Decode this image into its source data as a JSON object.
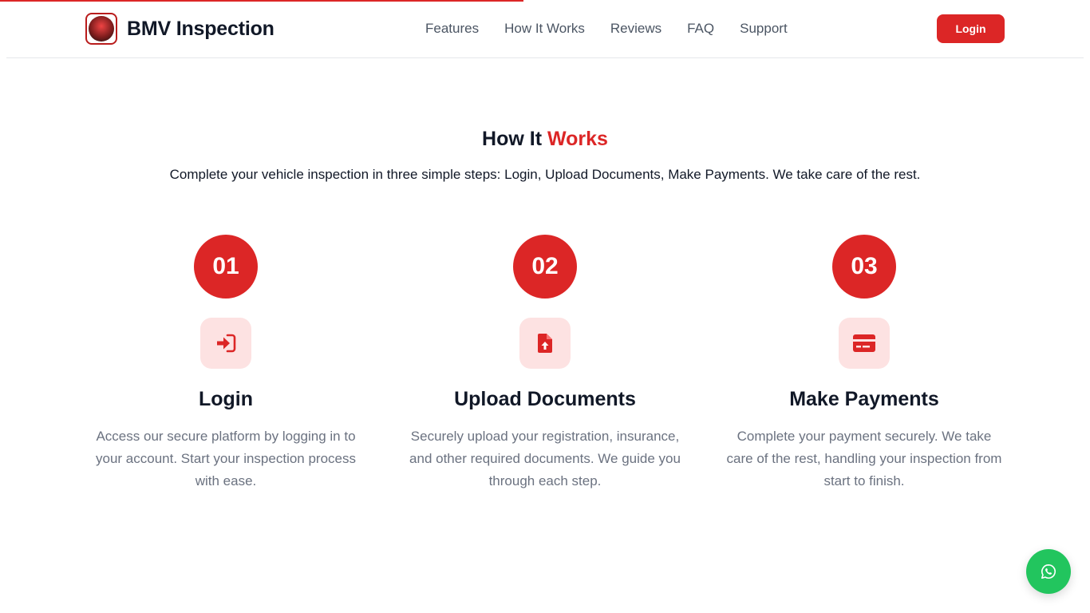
{
  "progress": {
    "percent": 48
  },
  "header": {
    "brand": "BMV Inspection",
    "nav": [
      "Features",
      "How It Works",
      "Reviews",
      "FAQ",
      "Support"
    ],
    "login_label": "Login"
  },
  "section": {
    "title_main": "How It ",
    "title_accent": "Works",
    "subtitle": "Complete your vehicle inspection in three simple steps: Login, Upload Documents, Make Payments. We take care of the rest."
  },
  "steps": [
    {
      "number": "01",
      "icon": "login-icon",
      "title": "Login",
      "description": "Access our secure platform by logging in to your account. Start your inspection process with ease."
    },
    {
      "number": "02",
      "icon": "file-upload-icon",
      "title": "Upload Documents",
      "description": "Securely upload your registration, insurance, and other required documents. We guide you through each step."
    },
    {
      "number": "03",
      "icon": "credit-card-icon",
      "title": "Make Payments",
      "description": "Complete your payment securely. We take care of the rest, handling your inspection from start to finish."
    }
  ],
  "colors": {
    "accent": "#dc2626",
    "icon_bg": "#fde2e2",
    "whatsapp": "#22c55e"
  }
}
